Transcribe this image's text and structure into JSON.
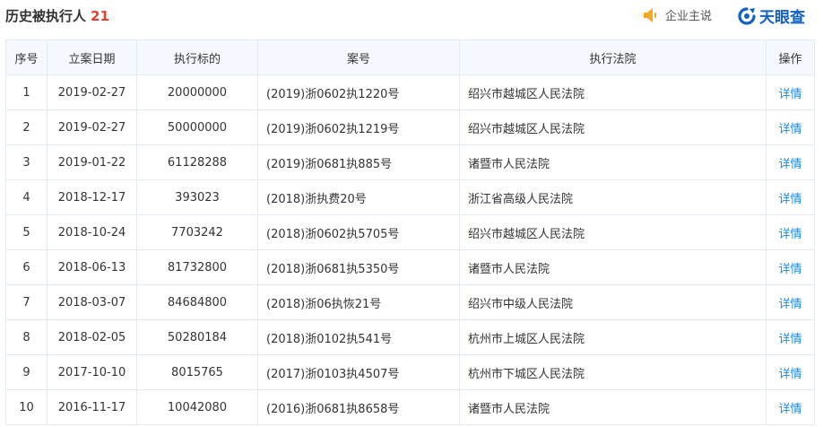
{
  "header": {
    "title": "历史被执行人",
    "count": "21",
    "voice_label": "企业主说",
    "brand_name": "天眼查"
  },
  "table": {
    "columns": [
      "序号",
      "立案日期",
      "执行标的",
      "案号",
      "执行法院",
      "操作"
    ],
    "rows": [
      {
        "no": "1",
        "date": "2019-02-27",
        "amount": "20000000",
        "case": "(2019)浙0602执1220号",
        "court": "绍兴市越城区人民法院",
        "action": "详情"
      },
      {
        "no": "2",
        "date": "2019-02-27",
        "amount": "50000000",
        "case": "(2019)浙0602执1219号",
        "court": "绍兴市越城区人民法院",
        "action": "详情"
      },
      {
        "no": "3",
        "date": "2019-01-22",
        "amount": "61128288",
        "case": "(2019)浙0681执885号",
        "court": "诸暨市人民法院",
        "action": "详情"
      },
      {
        "no": "4",
        "date": "2018-12-17",
        "amount": "393023",
        "case": "(2018)浙执费20号",
        "court": "浙江省高级人民法院",
        "action": "详情"
      },
      {
        "no": "5",
        "date": "2018-10-24",
        "amount": "7703242",
        "case": "(2018)浙0602执5705号",
        "court": "绍兴市越城区人民法院",
        "action": "详情"
      },
      {
        "no": "6",
        "date": "2018-06-13",
        "amount": "81732800",
        "case": "(2018)浙0681执5350号",
        "court": "诸暨市人民法院",
        "action": "详情"
      },
      {
        "no": "7",
        "date": "2018-03-07",
        "amount": "84684800",
        "case": "(2018)浙06执恢21号",
        "court": "绍兴市中级人民法院",
        "action": "详情"
      },
      {
        "no": "8",
        "date": "2018-02-05",
        "amount": "50280184",
        "case": "(2018)浙0102执541号",
        "court": "杭州市上城区人民法院",
        "action": "详情"
      },
      {
        "no": "9",
        "date": "2017-10-10",
        "amount": "8015765",
        "case": "(2017)浙0103执4507号",
        "court": "杭州市下城区人民法院",
        "action": "详情"
      },
      {
        "no": "10",
        "date": "2016-11-17",
        "amount": "10042080",
        "case": "(2016)浙0681执8658号",
        "court": "诸暨市人民法院",
        "action": "详情"
      }
    ]
  },
  "colors": {
    "accent": "#128bed",
    "count": "#e3412f",
    "brand": "#0f61c4",
    "header_bg": "#f5f9ff",
    "border": "#e4eaf2",
    "speaker_icon": "#f5a623"
  }
}
